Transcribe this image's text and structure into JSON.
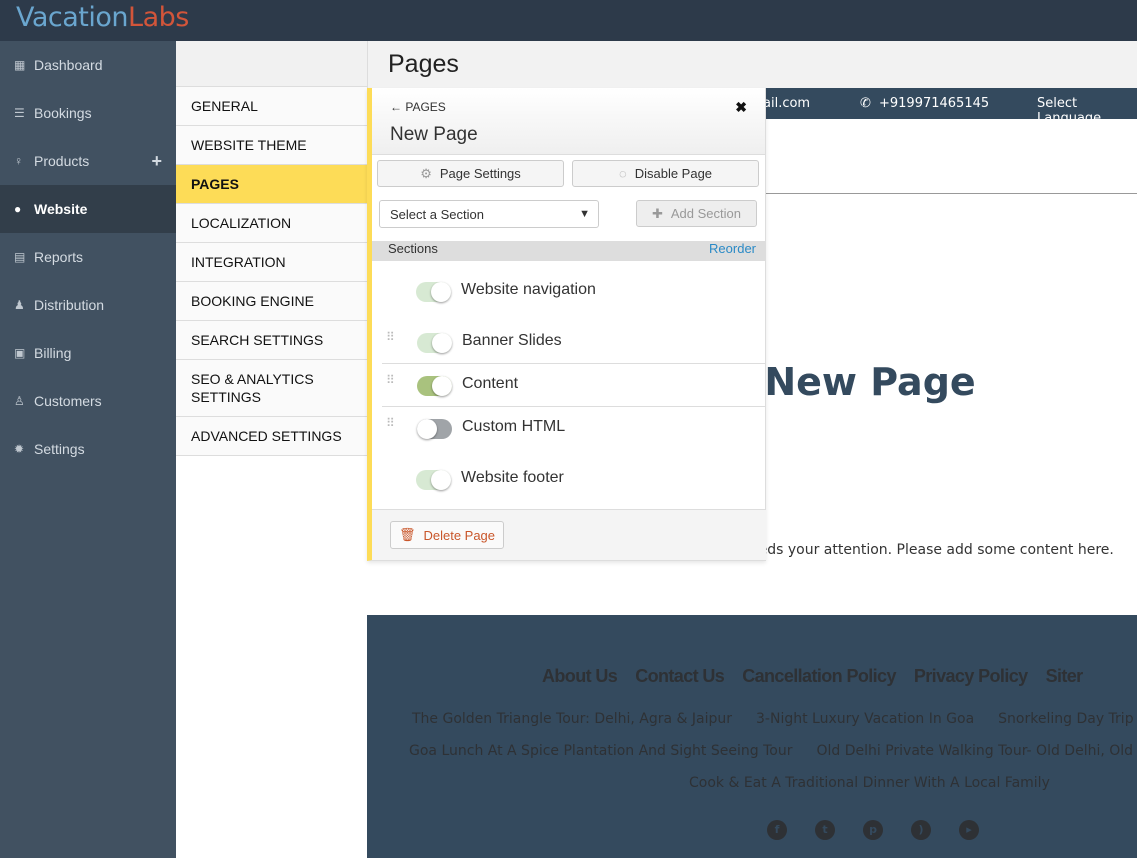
{
  "brand": {
    "part1": "Vacation",
    "part2": "Labs"
  },
  "sidebar": {
    "items": [
      {
        "label": "Dashboard",
        "icon": "calendar-icon"
      },
      {
        "label": "Bookings",
        "icon": "list-icon"
      },
      {
        "label": "Products",
        "icon": "lightbulb-icon",
        "action": "+"
      },
      {
        "label": "Website",
        "icon": "globe-icon",
        "active": true
      },
      {
        "label": "Reports",
        "icon": "report-icon"
      },
      {
        "label": "Distribution",
        "icon": "users-icon"
      },
      {
        "label": "Billing",
        "icon": "money-icon"
      },
      {
        "label": "Customers",
        "icon": "user-icon"
      },
      {
        "label": "Settings",
        "icon": "gear-icon"
      }
    ]
  },
  "subnav": {
    "items": [
      "GENERAL",
      "WEBSITE THEME",
      "PAGES",
      "LOCALIZATION",
      "INTEGRATION",
      "BOOKING ENGINE",
      "SEARCH SETTINGS",
      "SEO & ANALYTICS SETTINGS",
      "ADVANCED SETTINGS"
    ],
    "active": "PAGES"
  },
  "header": {
    "title": "Pages"
  },
  "preview": {
    "email_partial": "ail.com",
    "phone": "+919971465145",
    "language": "Select Language",
    "title": "New Page",
    "notice_partial": "eeds your attention. Please add some content here.",
    "footer_links": [
      "About Us",
      "Contact Us",
      "Cancellation Policy",
      "Privacy Policy",
      "Siter"
    ],
    "tours_row1": [
      "The Golden Triangle Tour: Delhi, Agra & Jaipur",
      "3-Night Luxury Vacation In Goa",
      "Snorkeling Day Trip"
    ],
    "tours_row2": [
      "Goa Lunch At A Spice Plantation And Sight Seeing Tour",
      "Old Delhi Private Walking Tour- Old Delhi, Old"
    ],
    "tours_row3": [
      "Cook & Eat A Traditional Dinner With A Local Family"
    ],
    "social": [
      "facebook-icon",
      "twitter-icon",
      "pinterest-icon",
      "rss-icon",
      "youtube-icon"
    ]
  },
  "panel": {
    "back": "← PAGES",
    "title": "New Page",
    "page_settings": "Page Settings",
    "disable_page": "Disable Page",
    "select_placeholder": "Select a Section",
    "add_section": "Add Section",
    "sections_label": "Sections",
    "reorder": "Reorder",
    "sections": [
      {
        "label": "Website navigation",
        "on": true,
        "locked": true
      },
      {
        "label": "Banner Slides",
        "on": true,
        "locked": true
      },
      {
        "label": "Content",
        "on": true,
        "locked": false
      },
      {
        "label": "Custom HTML",
        "on": false,
        "locked": false
      },
      {
        "label": "Website footer",
        "on": true,
        "locked": true
      }
    ],
    "delete_page": "Delete Page"
  },
  "colors": {
    "topbar": "#2d3a4a",
    "sidebar": "#415161",
    "accent": "#fddc57",
    "preview": "#344a5e",
    "link": "#2a8ac6",
    "toggle_on": "#a9c27e",
    "toggle_locked": "#d7e9d3",
    "toggle_off": "#a0a4a8"
  }
}
